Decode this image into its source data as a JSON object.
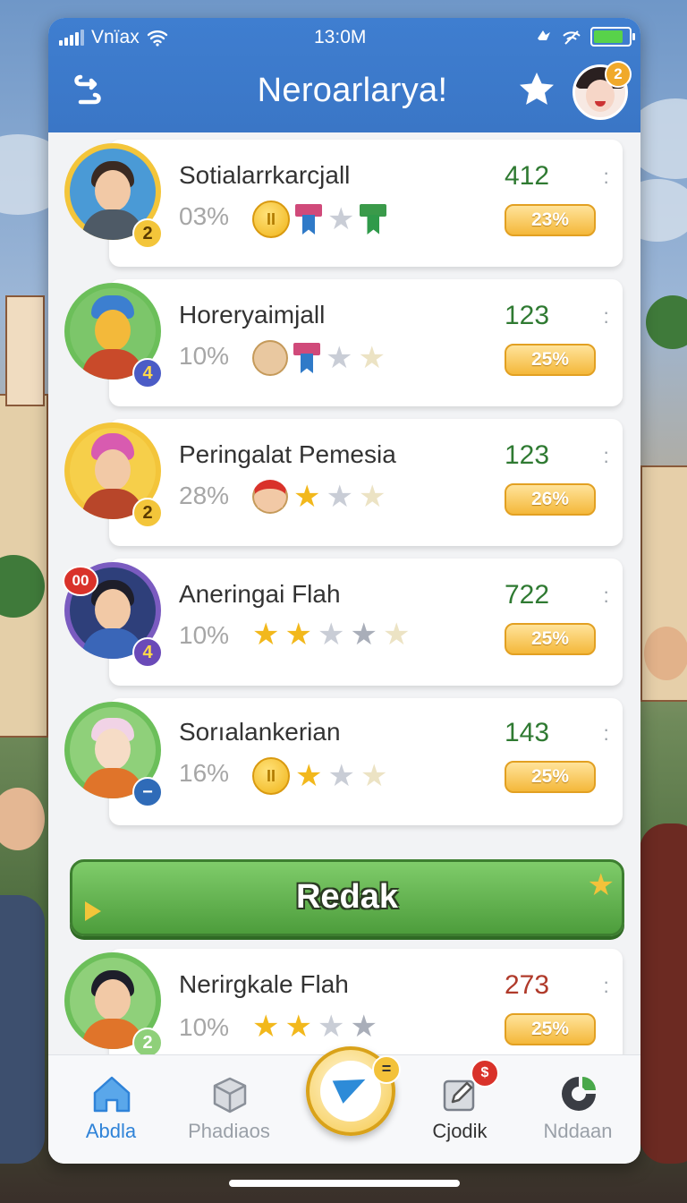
{
  "colors": {
    "header": "#3a76c6",
    "score_green": "#2f7a32",
    "score_red": "#b03a2a",
    "cta_green": "#4d9d3c",
    "pill_gold": "#f4b83a",
    "active_tab": "#2f83d8"
  },
  "status_bar": {
    "carrier": "Vnïax",
    "time": "13:0M"
  },
  "header": {
    "title": "Neroarlarya!",
    "back_icon": "back-arrow-icon",
    "star_icon": "star-icon",
    "avatar_badge": "2"
  },
  "players": [
    {
      "name": "Sotialarrkarcjall",
      "percent": "03%",
      "score": "412",
      "badge": "23%",
      "level": "2",
      "score_color": "green",
      "progress": 0.03
    },
    {
      "name": "Horeryaimjall",
      "percent": "10%",
      "score": "123",
      "badge": "25%",
      "level": "4",
      "score_color": "green",
      "progress": 0.1
    },
    {
      "name": "Peringalat Pemesia",
      "percent": "28%",
      "score": "123",
      "badge": "26%",
      "level": "2",
      "score_color": "green",
      "progress": 0.28
    },
    {
      "name": "Aneringai Flah",
      "percent": "10%",
      "score": "722",
      "badge": "25%",
      "level": "4",
      "extra_badge": "00",
      "score_color": "green",
      "progress": 0.1
    },
    {
      "name": "Sorıalankerian",
      "percent": "16%",
      "score": "143",
      "badge": "25%",
      "level": "−",
      "score_color": "green",
      "progress": 0.16
    },
    {
      "name": "Nerirgkale Flah",
      "percent": "10%",
      "score": "273",
      "badge": "25%",
      "level": "2",
      "score_color": "red",
      "progress": 0.1
    }
  ],
  "cta": {
    "label": "Redak"
  },
  "tabs": [
    {
      "label": "Abdla",
      "icon": "home-icon",
      "active": true
    },
    {
      "label": "Phadiaos",
      "icon": "box-icon",
      "active": false
    },
    {
      "label": "",
      "icon": "paper-plane-icon",
      "badge": "="
    },
    {
      "label": "Cjodik",
      "icon": "edit-icon",
      "badge": "$"
    },
    {
      "label": "Nddaan",
      "icon": "pie-chart-icon",
      "active": false
    }
  ]
}
